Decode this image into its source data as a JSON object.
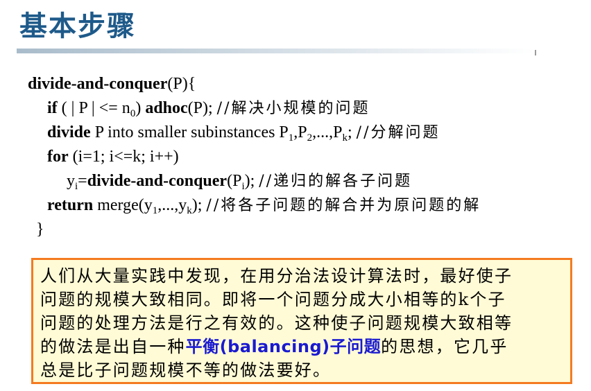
{
  "title": "基本步骤",
  "code": {
    "l1_fn": "divide-and-conquer",
    "l1_rest": "(P){",
    "l2_kw": "if",
    "l2_a": " ( | P | <= n",
    "l2_sub": "0",
    "l2_b": ") ",
    "l2_kw2": "adhoc",
    "l2_c": "(P);  ",
    "l2_cmt": "//解决小规模的问题",
    "l3_kw": "divide",
    "l3_a": " P into smaller subinstances P",
    "l3_s1": "1",
    "l3_b": ",P",
    "l3_s2": "2",
    "l3_c": ",...,P",
    "l3_s3": "k",
    "l3_d": ";  ",
    "l3_cmt": "//分解问题",
    "l4_kw": "for",
    "l4_rest": " (i=1; i<=k; i++)",
    "l5_a": "y",
    "l5_s1": "i",
    "l5_b": "=",
    "l5_fn": "divide-and-conquer",
    "l5_c": "(P",
    "l5_s2": "i",
    "l5_d": ");  ",
    "l5_cmt": "//递归的解各子问题",
    "l6_kw": "return",
    "l6_a": " merge(y",
    "l6_s1": "1",
    "l6_b": ",...,y",
    "l6_s2": "k",
    "l6_c": ");  ",
    "l6_cmt": "//将各子问题的解合并为原问题的解",
    "l7": "}"
  },
  "note": {
    "line1": "人们从大量实践中发现，在用分治法设计算法时，最好使子",
    "line2": "问题的规模大致相同。即将一个问题分成大小相等的k个子",
    "line3": "问题的处理方法是行之有效的。这种使子问题规模大致相等",
    "line4_a": "的做法是出自一种",
    "line4_em": "平衡(balancing)子问题",
    "line4_b": "的思想，它几乎",
    "line5": "总是比子问题规模不等的做法要好。"
  },
  "colors": {
    "title": "#1e5a8a",
    "emphasis": "#1a1ad0",
    "box_border": "#f47b20",
    "box_fill": "#fffbd6"
  }
}
